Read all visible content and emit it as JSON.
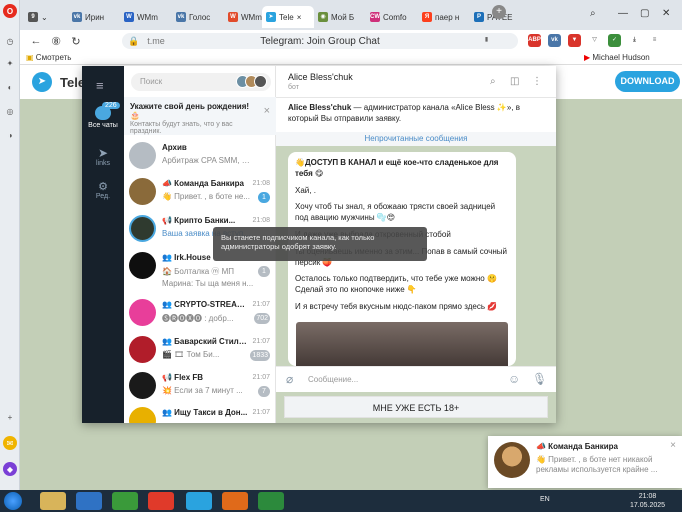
{
  "browser": {
    "tabs": [
      {
        "label": "Ирин",
        "favicon": "vk-icon",
        "color": "#4a76a8"
      },
      {
        "label": "WMm",
        "favicon": "wm-icon",
        "color": "#2a63c4"
      },
      {
        "label": "Голос",
        "favicon": "vk-icon",
        "color": "#4a76a8"
      },
      {
        "label": "WMm",
        "favicon": "wm-icon",
        "color": "#e14b2b"
      },
      {
        "label": "Tele",
        "favicon": "telegram-icon",
        "color": "#2aa3df",
        "active": true
      },
      {
        "label": "Мой Б",
        "favicon": "globe-icon",
        "color": "#6a8f3c"
      },
      {
        "label": "Comfo",
        "favicon": "cw-icon",
        "color": "#ce2f7a"
      },
      {
        "label": "паер н",
        "favicon": "yandex-icon",
        "color": "#fc3f1d"
      },
      {
        "label": "PAYEE",
        "favicon": "payeer-icon",
        "color": "#1d6fb8"
      }
    ],
    "tab_count_badge": "9",
    "url_domain": "t.me",
    "page_title": "Telegram: Join Group Chat",
    "bookmark": "Смотреть",
    "bookmark_right": "Michael Hudson"
  },
  "telegram_page": {
    "brand": "Tele",
    "download_label": "DOWNLOAD"
  },
  "sidebar": {
    "all_chats_label": "Все чаты",
    "all_chats_badge": "226",
    "links_label": "links",
    "edit_label": "Ред."
  },
  "chatlist": {
    "search_placeholder": "Поиск",
    "birthday_title": "Укажите свой день рождения! 🎂",
    "birthday_subtitle": "Контакты будут знать, что у вас праздник.",
    "chats": [
      {
        "name": "Архив",
        "time": "",
        "preview": "Арбитраж CPA SMM, Кейсы ...",
        "count": "",
        "avatar_color": "#b5bcc3"
      },
      {
        "name": "📣 Команда Банкира",
        "time": "21:08",
        "preview": "👋 Привет. , в боте не...",
        "count": "1",
        "avatar_color": "#8a6a3a",
        "blue": true
      },
      {
        "name": "📢 Крипто Банки...",
        "time": "21:08",
        "preview": "Ваша заявка на вступление...",
        "count": "",
        "avatar_color": "#2f3a2f"
      },
      {
        "name": "👥 Irk.House",
        "time": "",
        "preview": "🏠 Болталка  ⓜ МП",
        "preview2": "Марина: Ты ща меня н...",
        "count": "1",
        "avatar_color": "#0f0f0f"
      },
      {
        "name": "👥 CRYPTO-STREAMI...",
        "time": "21:07",
        "preview": "🅢🅡🅞🅧🅞 : добр...",
        "count": "702",
        "avatar_color": "#e83e9a"
      },
      {
        "name": "👥 Баварский Стиль...",
        "time": "21:07",
        "preview": "🎬 🎞 Том Би...",
        "count": "1833",
        "avatar_color": "#b11d2a"
      },
      {
        "name": "📢 Flex FB",
        "time": "21:07",
        "preview": "💥 Если за 7 минут ...",
        "count": "7",
        "avatar_color": "#1a1a1a"
      },
      {
        "name": "👥 Ищу Такси в Дон...",
        "time": "21:07",
        "preview": "",
        "count": "",
        "avatar_color": "#e8b000"
      }
    ]
  },
  "tooltip": "Вы станете подписчиком канала, как только администраторы одобрят заявку.",
  "chat": {
    "title": "Alice Bless'chuk",
    "subtitle": "бот",
    "admin_notice_name": "Alice Bless'chuk",
    "admin_notice_rest": " — администратор канала «Alice Bless ✨», в который Вы отправили заявку.",
    "unread_label": "Непрочитанные сообщения",
    "message_lines": [
      "👋ДОСТУП В КАНАЛ и ещё кое-что сладенькое для тебя 😋",
      "Хай, .",
      "Хочу чтоб ты знал, я обожааю трясти своей задницей под авацию мужчины 🫧😍",
      "И даже уже выбрала откровенный стобой",
      "ты оцениваешь именно за этим... Попав в самый сочный персик 🍑",
      "Осталось только подтвердить, что тебе уже можно 🤫 Сделай это по кнопочке ниже 👇",
      "И я встречу тебя вкусным нюдс-паком прямо здесь 💋"
    ],
    "compose_placeholder": "Сообщение...",
    "join_button": "МНЕ УЖЕ ЕСТЬ 18+"
  },
  "notification": {
    "title": "📣 Команда Банкира",
    "text": "👋 Привет. , в боте нет никакой рекламы используется крайне ..."
  },
  "taskbar": {
    "lang": "EN",
    "time": "21:08",
    "date": "17.05.2025"
  }
}
